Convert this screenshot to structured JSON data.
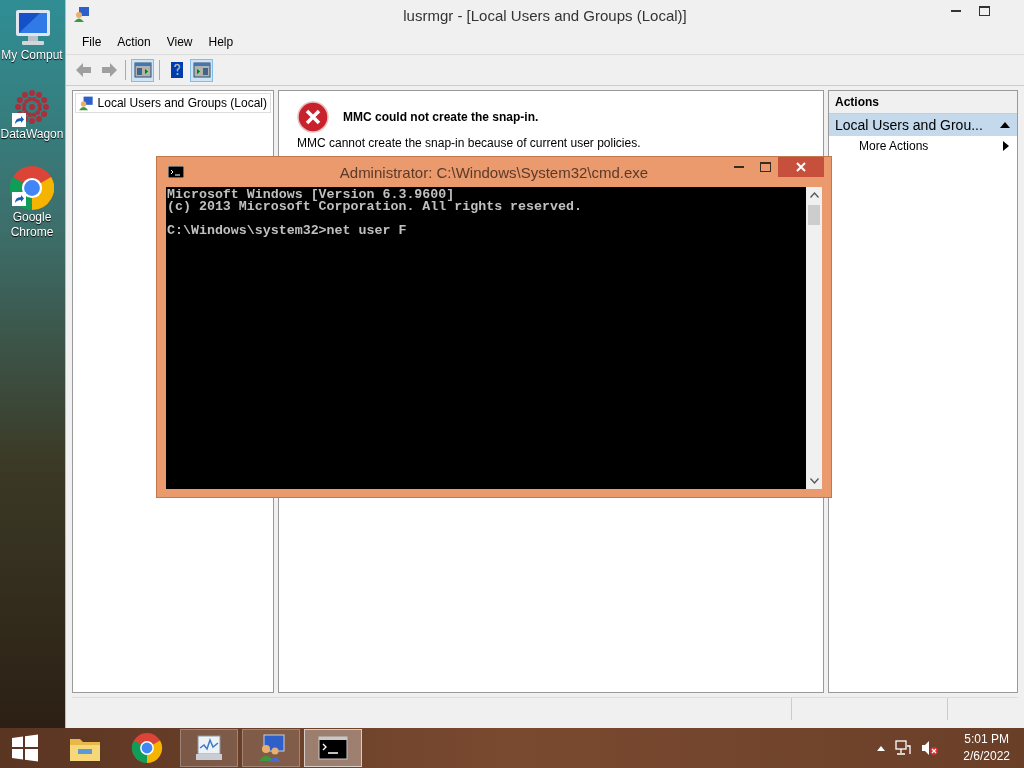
{
  "desktop_icons": [
    {
      "kind": "computer",
      "label": "My Comput",
      "shortcut": false
    },
    {
      "kind": "flower",
      "label": "DataWagon",
      "shortcut": true
    },
    {
      "kind": "browser",
      "label": "Google Chrome",
      "shortcut": true
    }
  ],
  "mmc_window": {
    "title": "lusrmgr - [Local Users and Groups (Local)]",
    "menu": [
      "File",
      "Action",
      "View",
      "Help"
    ],
    "toolbar": [
      {
        "kind": "back",
        "selected": false,
        "disabled": true
      },
      {
        "kind": "forward",
        "selected": false,
        "disabled": true
      },
      {
        "kind": "tree",
        "selected": true,
        "disabled": false
      },
      {
        "kind": "help",
        "selected": false,
        "disabled": false
      },
      {
        "kind": "actionpane",
        "selected": true,
        "disabled": false
      }
    ],
    "tree": [
      {
        "label": "Local Users and Groups (Local)",
        "selected": false
      }
    ],
    "error": {
      "title": "MMC could not create the snap-in.",
      "message": "MMC cannot create the snap-in because of current user policies."
    },
    "actions": {
      "header": "Actions",
      "section": "Local Users and Grou...",
      "expanded": true,
      "items": [
        {
          "label": "More Actions"
        }
      ]
    }
  },
  "cmd_window": {
    "title": "Administrator: C:\\Windows\\System32\\cmd.exe",
    "output": [
      "Microsoft Windows [Version 6.3.9600]",
      "(c) 2013 Microsoft Corporation. All rights reserved."
    ],
    "prompt": "C:\\Windows\\system32>net user F"
  },
  "taskbar": {
    "items": [
      {
        "kind": "folder",
        "running": false,
        "selected": false
      },
      {
        "kind": "browser",
        "running": false,
        "selected": false
      },
      {
        "kind": "monitor",
        "running": true,
        "selected": false
      },
      {
        "kind": "users",
        "running": true,
        "selected": false
      },
      {
        "kind": "console",
        "running": true,
        "selected": true
      }
    ],
    "time": "5:01 PM",
    "date": "2/6/2022",
    "volume_muted": true
  }
}
